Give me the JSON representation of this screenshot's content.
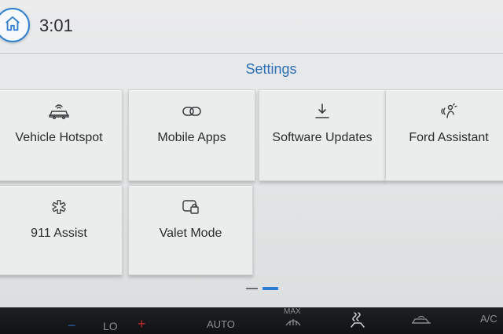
{
  "status": {
    "time": "3:01"
  },
  "page": {
    "title": "Settings"
  },
  "tiles": [
    {
      "label": "Vehicle Hotspot",
      "icon": "car-wifi-icon"
    },
    {
      "label": "Mobile Apps",
      "icon": "link-icon"
    },
    {
      "label": "Software Updates",
      "icon": "download-icon"
    },
    {
      "label": "Ford Assistant",
      "icon": "voice-assistant-icon"
    },
    {
      "label": "911 Assist",
      "icon": "emergency-star-icon"
    },
    {
      "label": "Valet Mode",
      "icon": "valet-lock-icon"
    }
  ],
  "pager": {
    "pages": 2,
    "current": 2
  },
  "climate": {
    "minus": "−",
    "temp": "LO",
    "plus": "+",
    "auto": "AUTO",
    "max": "MAX",
    "ac": "A/C"
  },
  "colors": {
    "accent": "#2c7fd0",
    "title": "#2d6fb6",
    "plus": "#c0282a",
    "minus": "#2c5fa8"
  }
}
